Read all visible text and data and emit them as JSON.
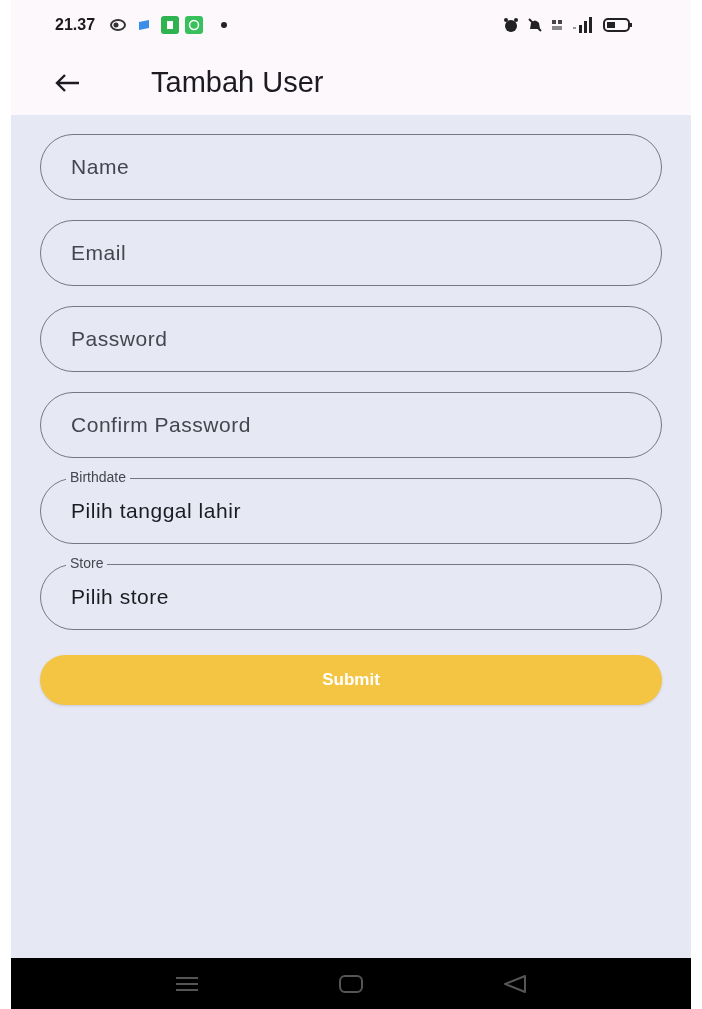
{
  "status_bar": {
    "time": "21.37"
  },
  "app_bar": {
    "title": "Tambah User"
  },
  "fields": [
    {
      "kind": "input",
      "placeholder": "Name"
    },
    {
      "kind": "input",
      "placeholder": "Email"
    },
    {
      "kind": "input",
      "placeholder": "Password"
    },
    {
      "kind": "input",
      "placeholder": "Confirm Password"
    },
    {
      "kind": "picker",
      "label": "Birthdate",
      "value": "Pilih tanggal lahir"
    },
    {
      "kind": "picker",
      "label": "Store",
      "value": "Pilih store"
    }
  ],
  "submit_button": {
    "label": "Submit"
  }
}
